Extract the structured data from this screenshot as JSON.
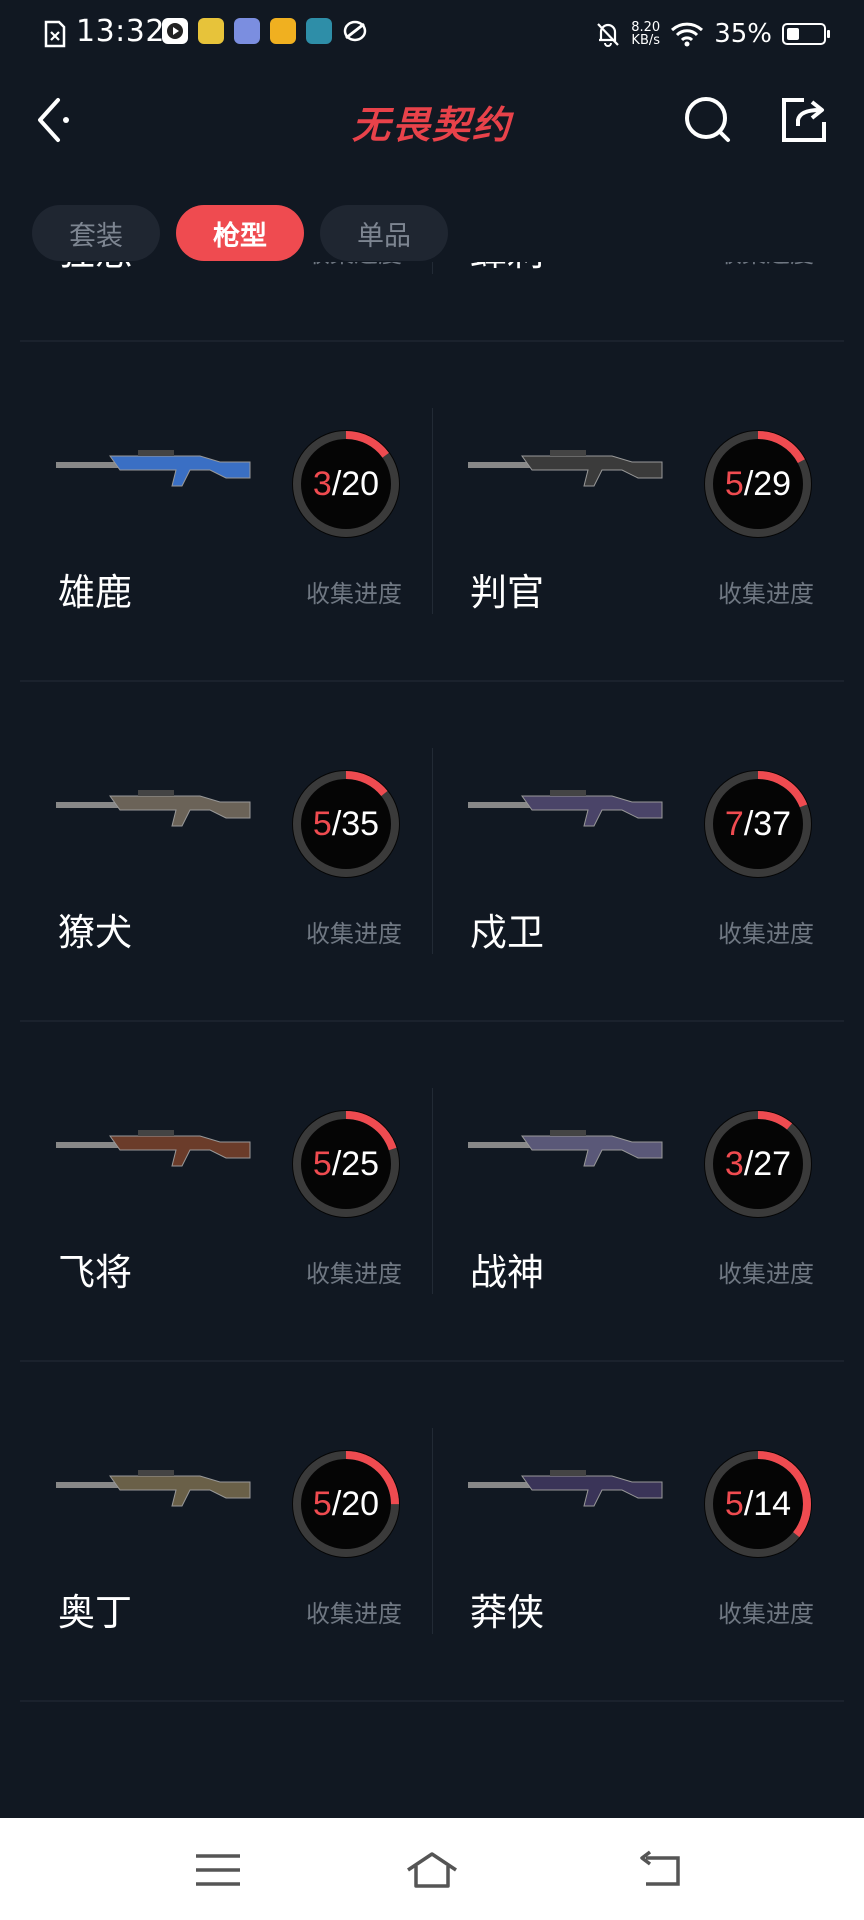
{
  "status_bar": {
    "time": "13:32",
    "net_speed_value": "8.20",
    "net_speed_unit": "KB/s",
    "battery_percent": "35%",
    "battery_level": 0.35,
    "app_icons": [
      "video-app-icon",
      "game-app-icon-1",
      "game-app-icon-2",
      "game-app-icon-3",
      "game-app-icon-4",
      "browser-app-icon"
    ]
  },
  "header": {
    "logo_text": "无畏契约"
  },
  "tabs": [
    {
      "label": "套装",
      "active": false
    },
    {
      "label": "枪型",
      "active": true
    },
    {
      "label": "单品",
      "active": false
    }
  ],
  "progress_label": "收集进度",
  "partial_row": [
    {
      "name": "狂怒"
    },
    {
      "name": "蜂刺"
    }
  ],
  "weapons": [
    {
      "name": "雄鹿",
      "collected": 3,
      "total": 20,
      "gun_color": "#3a6fc4"
    },
    {
      "name": "判官",
      "collected": 5,
      "total": 29,
      "gun_color": "#3b3b3b"
    },
    {
      "name": "獠犬",
      "collected": 5,
      "total": 35,
      "gun_color": "#6b6358"
    },
    {
      "name": "戍卫",
      "collected": 7,
      "total": 37,
      "gun_color": "#4a4468"
    },
    {
      "name": "飞将",
      "collected": 5,
      "total": 25,
      "gun_color": "#6b3c2a"
    },
    {
      "name": "战神",
      "collected": 3,
      "total": 27,
      "gun_color": "#5a5878"
    },
    {
      "name": "奥丁",
      "collected": 5,
      "total": 20,
      "gun_color": "#6a6048"
    },
    {
      "name": "莽侠",
      "collected": 5,
      "total": 14,
      "gun_color": "#3a3458"
    }
  ],
  "colors": {
    "accent": "#ef4b50",
    "background": "#111822",
    "ring_track": "#3a3a3a"
  }
}
